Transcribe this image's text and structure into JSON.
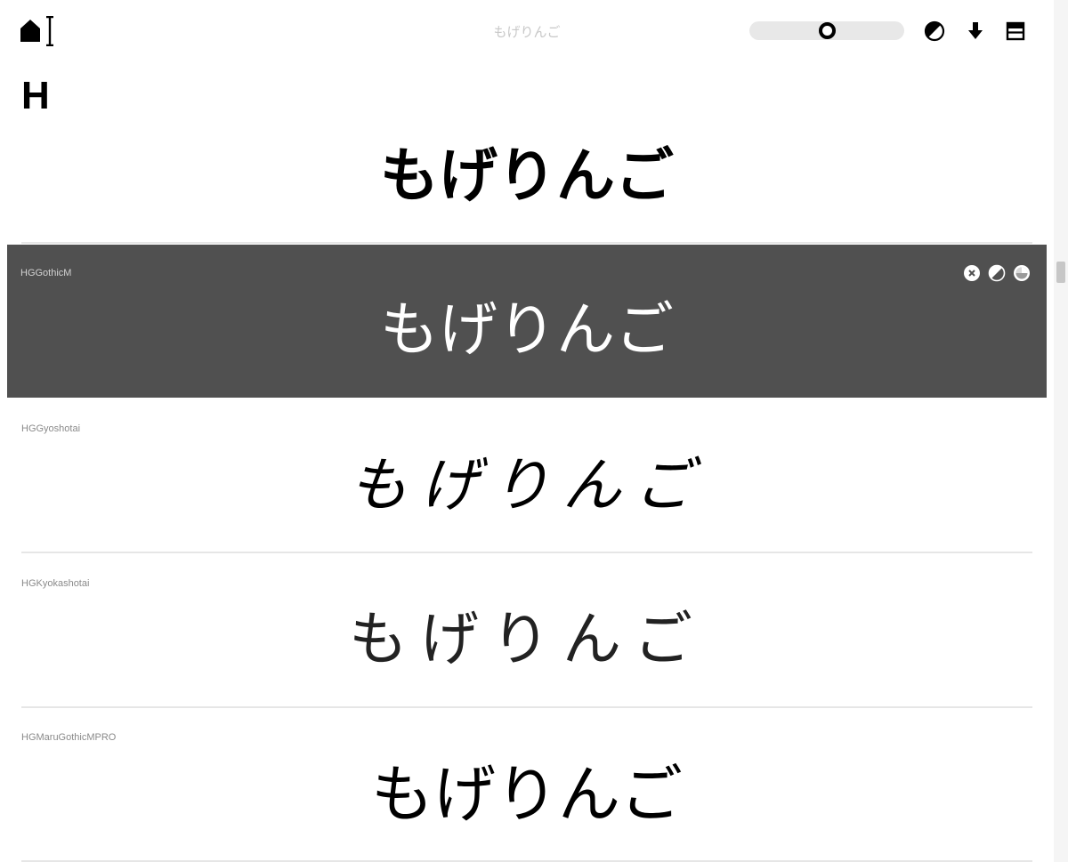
{
  "header": {
    "title": "もげりんご",
    "slider_value": 0.5,
    "icons": [
      "home-cursor-icon",
      "contrast-icon",
      "download-arrow-icon",
      "layout-panel-icon"
    ]
  },
  "section": {
    "letter": "H"
  },
  "fonts": [
    {
      "name": "",
      "sample": "もげりんご",
      "style": "bold",
      "active": false
    },
    {
      "name": "HGGothicM",
      "sample": "もげりんご",
      "style": "normal",
      "active": true
    },
    {
      "name": "HGGyoshotai",
      "sample": "もげりんご",
      "style": "brush",
      "active": false
    },
    {
      "name": "HGKyokashotai",
      "sample": "もげりんご",
      "style": "thin",
      "active": false
    },
    {
      "name": "HGMaruGothicMPRO",
      "sample": "もげりんご",
      "style": "round",
      "active": false
    }
  ],
  "colors": {
    "active_card_bg": "#505050",
    "divider": "#e6e6e6",
    "name_label": "#8a8a8a",
    "slider_track": "#e8e8e8"
  }
}
